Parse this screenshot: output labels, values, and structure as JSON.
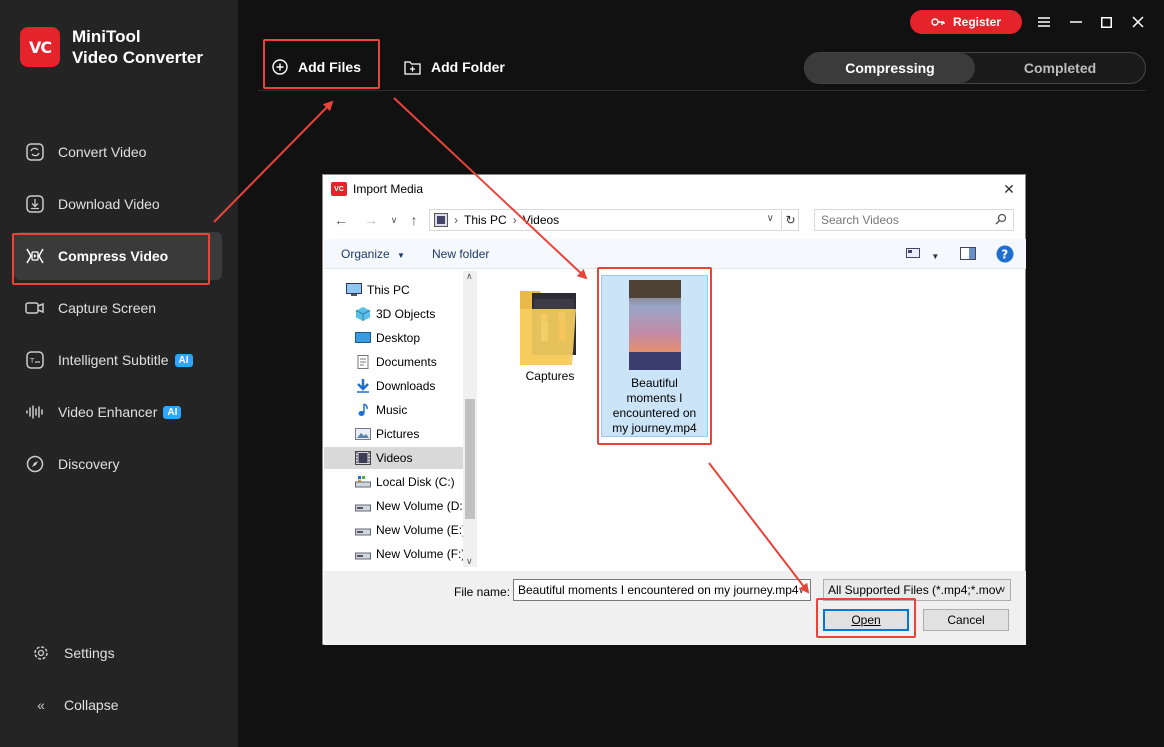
{
  "app": {
    "name_line1": "MiniTool",
    "name_line2": "Video Converter",
    "logo_text": "VC"
  },
  "sidebar": {
    "items": [
      {
        "label": "Convert Video",
        "icon": "convert-icon"
      },
      {
        "label": "Download Video",
        "icon": "download-icon"
      },
      {
        "label": "Compress Video",
        "icon": "compress-icon",
        "active": true
      },
      {
        "label": "Capture Screen",
        "icon": "camera-icon"
      },
      {
        "label": "Intelligent Subtitle",
        "icon": "subtitle-icon",
        "badge": "AI"
      },
      {
        "label": "Video Enhancer",
        "icon": "enhancer-icon",
        "badge": "AI"
      },
      {
        "label": "Discovery",
        "icon": "compass-icon"
      }
    ],
    "settings_label": "Settings",
    "collapse_label": "Collapse"
  },
  "toolbar": {
    "add_files": "Add Files",
    "add_folder": "Add Folder"
  },
  "tabs": {
    "compressing": "Compressing",
    "completed": "Completed"
  },
  "header": {
    "register": "Register"
  },
  "dialog": {
    "title": "Import Media",
    "breadcrumb": [
      "This PC",
      "Videos"
    ],
    "search_placeholder": "Search Videos",
    "organize": "Organize",
    "new_folder": "New folder",
    "tree": [
      {
        "label": "This PC",
        "icon": "pc-icon"
      },
      {
        "label": "3D Objects",
        "icon": "cube-icon"
      },
      {
        "label": "Desktop",
        "icon": "desktop-icon"
      },
      {
        "label": "Documents",
        "icon": "document-icon"
      },
      {
        "label": "Downloads",
        "icon": "download-icon"
      },
      {
        "label": "Music",
        "icon": "music-icon"
      },
      {
        "label": "Pictures",
        "icon": "picture-icon"
      },
      {
        "label": "Videos",
        "icon": "video-icon",
        "selected": true
      },
      {
        "label": "Local Disk (C:)",
        "icon": "disk-icon"
      },
      {
        "label": "New Volume (D:)",
        "icon": "drive-icon"
      },
      {
        "label": "New Volume (E:)",
        "icon": "drive-icon"
      },
      {
        "label": "New Volume (F:)",
        "icon": "drive-icon"
      }
    ],
    "files": [
      {
        "name": "Captures",
        "type": "folder"
      },
      {
        "name": "Beautiful moments I encountered on my journey.mp4",
        "type": "video",
        "selected": true
      }
    ],
    "file_name_label": "File name:",
    "file_name_value": "Beautiful moments I encountered on my journey.mp4",
    "file_type": "All Supported Files (*.mp4;*.mov",
    "open": "Open",
    "cancel": "Cancel"
  },
  "colors": {
    "accent": "#e4232a",
    "highlight": "#e8443a",
    "sidebar_bg": "#242424",
    "main_bg": "#111111"
  }
}
